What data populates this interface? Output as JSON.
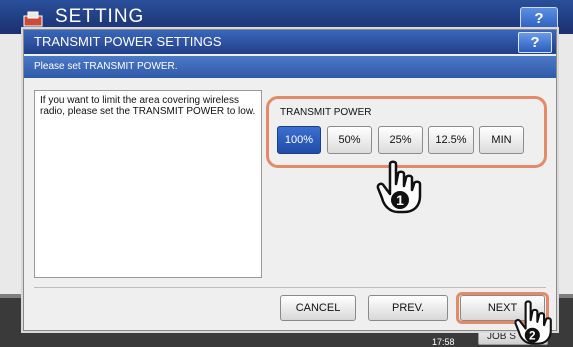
{
  "background": {
    "title": "SETTING",
    "help": "?",
    "time": "17:58",
    "jobs_label": "JOB S"
  },
  "dialog": {
    "title": "TRANSMIT POWER SETTINGS",
    "help": "?",
    "message": "Please set TRANSMIT POWER.",
    "description": "If you want to limit the area covering wireless radio, please set the TRANSMIT POWER to low.",
    "transmit_power": {
      "label": "TRANSMIT POWER",
      "options": [
        "100%",
        "50%",
        "25%",
        "12.5%",
        "MIN"
      ],
      "selected": "100%"
    },
    "actions": {
      "cancel": "CANCEL",
      "prev": "PREV.",
      "next": "NEXT"
    }
  },
  "callouts": {
    "step1": "1",
    "step2": "2"
  },
  "colors": {
    "titlebar": "#213f86",
    "message_bar": "#2f5aa8",
    "selected_button": "#1f4da8",
    "highlight": "#e48a66"
  }
}
